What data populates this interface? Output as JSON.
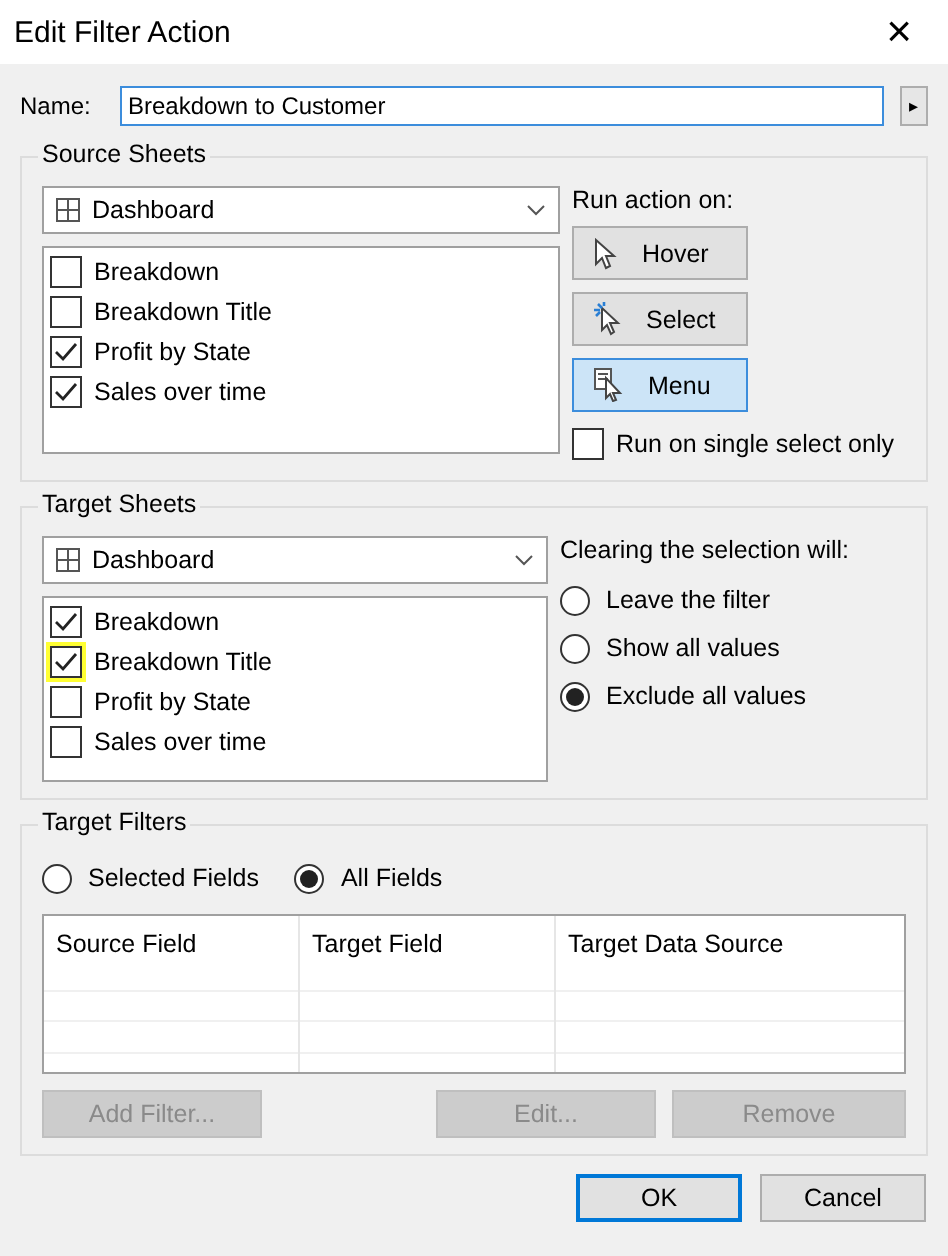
{
  "window": {
    "title": "Edit Filter Action",
    "close": "×"
  },
  "name_field": {
    "label": "Name:",
    "value": "Breakdown to Customer",
    "menu_arrow": "▸"
  },
  "source_sheets": {
    "title": "Source Sheets",
    "dropdown": "Dashboard",
    "sheets": [
      {
        "label": "Breakdown",
        "checked": false,
        "highlighted": false
      },
      {
        "label": "Breakdown Title",
        "checked": false,
        "highlighted": false
      },
      {
        "label": "Profit by State",
        "checked": true,
        "highlighted": false
      },
      {
        "label": "Sales over time",
        "checked": true,
        "highlighted": false
      }
    ],
    "run_action_label": "Run action on:",
    "run_actions": [
      {
        "kind": "hover",
        "label": "Hover",
        "selected": false
      },
      {
        "kind": "select",
        "label": "Select",
        "selected": false
      },
      {
        "kind": "menu",
        "label": "Menu",
        "selected": true
      }
    ],
    "single_select": {
      "label": "Run on single select only",
      "checked": false
    }
  },
  "target_sheets": {
    "title": "Target Sheets",
    "dropdown": "Dashboard",
    "sheets": [
      {
        "label": "Breakdown",
        "checked": true,
        "highlighted": false
      },
      {
        "label": "Breakdown Title",
        "checked": true,
        "highlighted": true
      },
      {
        "label": "Profit by State",
        "checked": false,
        "highlighted": false
      },
      {
        "label": "Sales over time",
        "checked": false,
        "highlighted": false
      }
    ],
    "clearing_label": "Clearing the selection will:",
    "clearing_options": [
      {
        "label": "Leave the filter",
        "selected": false
      },
      {
        "label": "Show all values",
        "selected": false
      },
      {
        "label": "Exclude all values",
        "selected": true
      }
    ]
  },
  "target_filters": {
    "title": "Target Filters",
    "scope": [
      {
        "label": "Selected Fields",
        "selected": false
      },
      {
        "label": "All Fields",
        "selected": true
      }
    ],
    "columns": [
      "Source Field",
      "Target Field",
      "Target Data Source"
    ],
    "buttons": [
      {
        "label": "Add Filter...",
        "disabled": true
      },
      {
        "label": "Edit...",
        "disabled": true
      },
      {
        "label": "Remove",
        "disabled": true
      }
    ]
  },
  "dialog_buttons": [
    {
      "label": "OK",
      "default": true
    },
    {
      "label": "Cancel",
      "default": false
    }
  ]
}
